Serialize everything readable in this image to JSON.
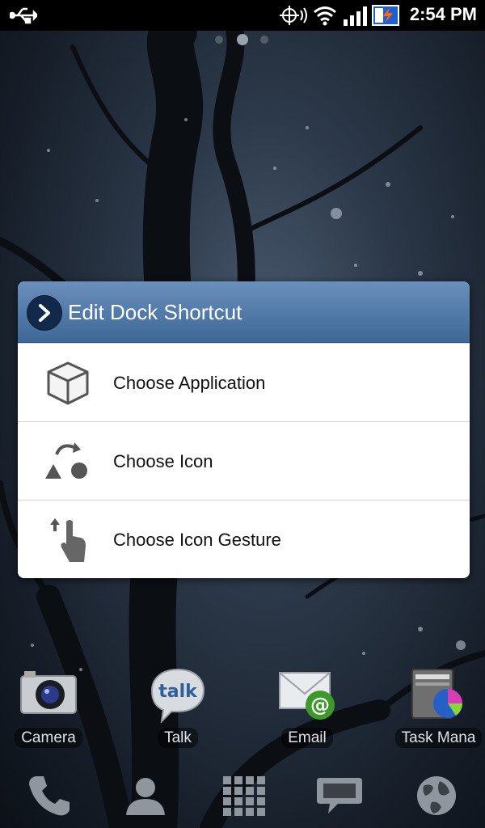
{
  "status_bar": {
    "time": "2:54 PM",
    "icons": [
      "usb-icon",
      "gps-icon",
      "wifi-icon",
      "signal-icon",
      "battery-charging-icon"
    ]
  },
  "dialog": {
    "title": "Edit Dock Shortcut",
    "items": [
      {
        "label": "Choose Application",
        "icon": "cube-icon"
      },
      {
        "label": "Choose Icon",
        "icon": "shapes-icon"
      },
      {
        "label": "Choose Icon Gesture",
        "icon": "gesture-hand-icon"
      }
    ]
  },
  "dock_apps": [
    {
      "label": "Camera",
      "icon": "camera-icon"
    },
    {
      "label": "Talk",
      "icon": "talk-icon"
    },
    {
      "label": "Email",
      "icon": "email-icon"
    },
    {
      "label": "Task Mana",
      "icon": "task-manager-icon"
    }
  ],
  "bottom_bar": [
    "phone-icon",
    "contacts-icon",
    "app-drawer-icon",
    "messaging-icon",
    "browser-icon"
  ],
  "home_pages": {
    "count": 3,
    "current": 2
  }
}
